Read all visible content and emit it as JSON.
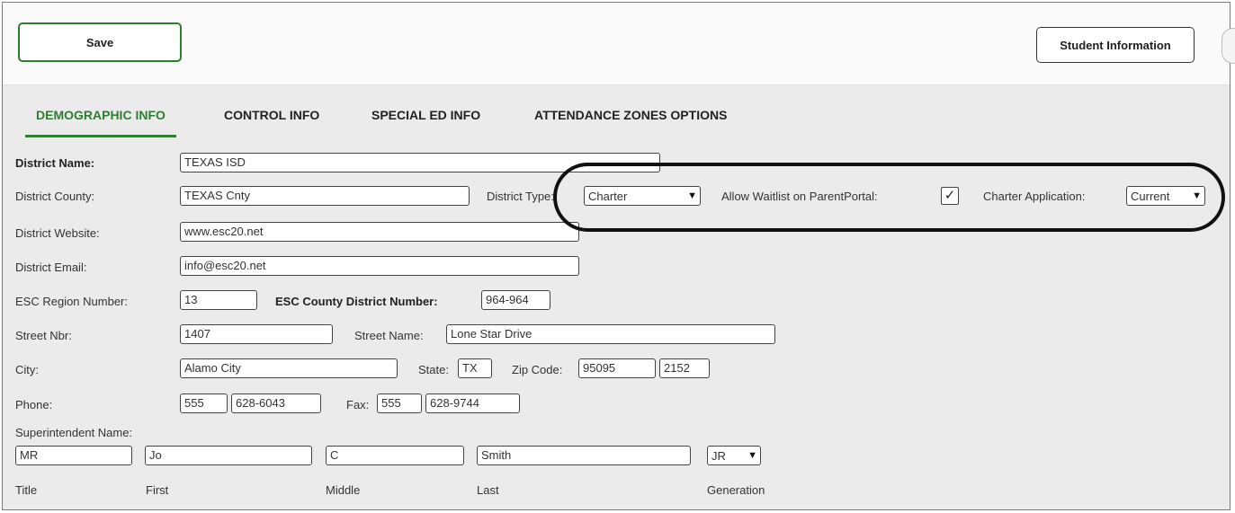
{
  "toolbar": {
    "save_label": "Save",
    "student_info_label": "Student Information"
  },
  "tabs": [
    {
      "label": "DEMOGRAPHIC INFO"
    },
    {
      "label": "CONTROL INFO"
    },
    {
      "label": "SPECIAL ED INFO"
    },
    {
      "label": "ATTENDANCE ZONES OPTIONS"
    }
  ],
  "district": {
    "name_label": "District Name:",
    "name": "TEXAS ISD",
    "county_label": "District County:",
    "county": "TEXAS Cnty",
    "type_label": "District Type:",
    "type": "Charter",
    "waitlist_label": "Allow Waitlist on ParentPortal:",
    "waitlist_checked": "✓",
    "charter_app_label": "Charter Application:",
    "charter_app": "Current",
    "website_label": "District Website:",
    "website": "www.esc20.net",
    "email_label": "District Email:",
    "email": "info@esc20.net",
    "region_label": "ESC Region Number:",
    "region": "13",
    "county_district_label": "ESC County District Number:",
    "county_district": "964-964",
    "street_nbr_label": "Street Nbr:",
    "street_nbr": "1407",
    "street_name_label": "Street Name:",
    "street_name": "Lone Star Drive",
    "city_label": "City:",
    "city": "Alamo City",
    "state_label": "State:",
    "state": "TX",
    "zip_label": "Zip Code:",
    "zip": "95095",
    "zip4": "2152",
    "phone_label": "Phone:",
    "phone_area": "555",
    "phone_num": "628-6043",
    "fax_label": "Fax:",
    "fax_area": "555",
    "fax_num": "628-9744"
  },
  "superintendent": {
    "section_label": "Superintendent Name:",
    "title": "MR",
    "first": "Jo",
    "middle": "C",
    "last": "Smith",
    "generation": "JR",
    "title_caption": "Title",
    "first_caption": "First",
    "middle_caption": "Middle",
    "last_caption": "Last",
    "generation_caption": "Generation"
  },
  "annotation": {
    "color": "#111111"
  }
}
